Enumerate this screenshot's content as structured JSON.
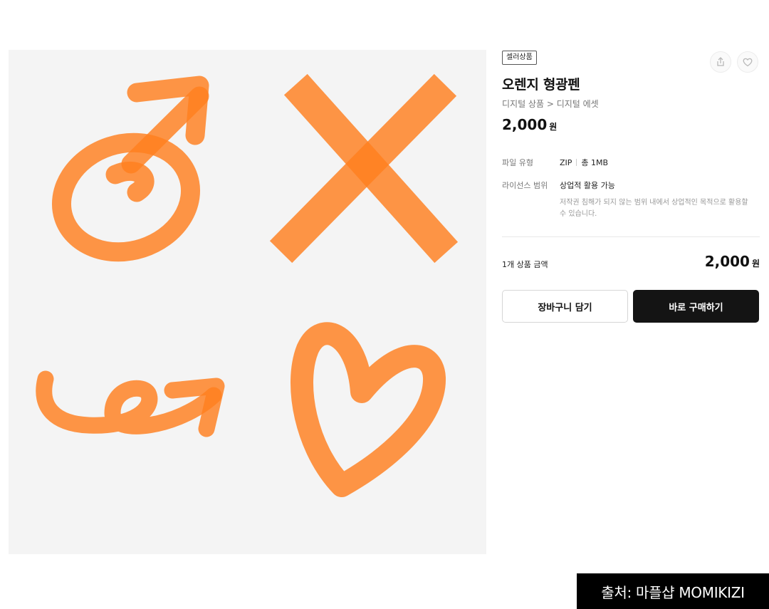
{
  "product": {
    "badge": "셀러상품",
    "title": "오렌지 형광펜",
    "breadcrumb": "디지털 상품 > 디지털 에셋",
    "price": "2,000",
    "currency": "원",
    "accent_color": "#ff7f1e"
  },
  "details": {
    "file_type_label": "파일 유형",
    "file_format": "ZIP",
    "file_size": "총 1MB",
    "license_label": "라이선스 범위",
    "license_value": "상업적 활용 가능",
    "license_note": "저작권 침해가 되지 않는 범위 내에서 상업적인 목적으로 활용할 수 있습니다."
  },
  "total": {
    "label": "1개 상품 금액",
    "amount": "2,000",
    "currency": "원"
  },
  "actions": {
    "cart": "장바구니 담기",
    "buy": "바로 구매하기",
    "share_icon": "share-icon",
    "like_icon": "heart-icon"
  },
  "watermark": "출처: 마플샵 MOMIKIZI"
}
